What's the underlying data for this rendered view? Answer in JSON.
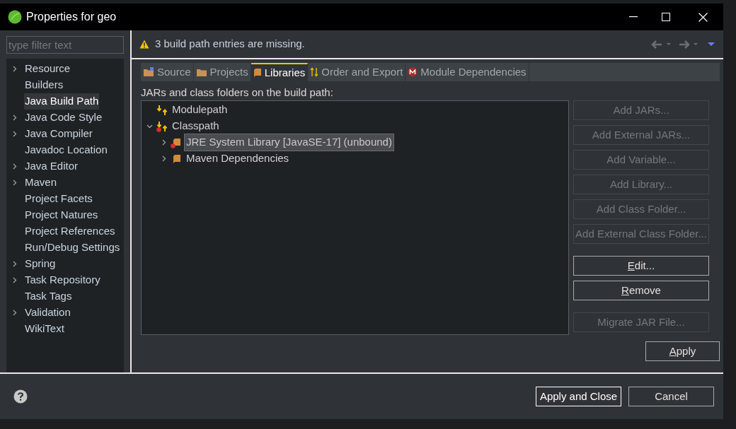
{
  "window": {
    "title": "Properties for geo"
  },
  "filter": {
    "placeholder": "type filter text"
  },
  "sidebar": {
    "items": [
      {
        "label": "Resource",
        "expandable": true,
        "selected": false
      },
      {
        "label": "Builders",
        "expandable": false,
        "selected": false
      },
      {
        "label": "Java Build Path",
        "expandable": false,
        "selected": true
      },
      {
        "label": "Java Code Style",
        "expandable": true,
        "selected": false
      },
      {
        "label": "Java Compiler",
        "expandable": true,
        "selected": false
      },
      {
        "label": "Javadoc Location",
        "expandable": false,
        "selected": false
      },
      {
        "label": "Java Editor",
        "expandable": true,
        "selected": false
      },
      {
        "label": "Maven",
        "expandable": true,
        "selected": false
      },
      {
        "label": "Project Facets",
        "expandable": false,
        "selected": false
      },
      {
        "label": "Project Natures",
        "expandable": false,
        "selected": false
      },
      {
        "label": "Project References",
        "expandable": false,
        "selected": false
      },
      {
        "label": "Run/Debug Settings",
        "expandable": false,
        "selected": false
      },
      {
        "label": "Spring",
        "expandable": true,
        "selected": false
      },
      {
        "label": "Task Repository",
        "expandable": true,
        "selected": false
      },
      {
        "label": "Task Tags",
        "expandable": false,
        "selected": false
      },
      {
        "label": "Validation",
        "expandable": true,
        "selected": false
      },
      {
        "label": "WikiText",
        "expandable": false,
        "selected": false
      }
    ]
  },
  "message": {
    "text": "3 build path entries are missing."
  },
  "tabs": [
    {
      "label": "Source",
      "kind": "source",
      "selected": false
    },
    {
      "label": "Projects",
      "kind": "projects",
      "selected": false
    },
    {
      "label": "Libraries",
      "kind": "libraries",
      "selected": true
    },
    {
      "label": "Order and Export",
      "kind": "order",
      "selected": false
    },
    {
      "label": "Module Dependencies",
      "kind": "module",
      "selected": false
    }
  ],
  "tree_label": "JARs and class folders on the build path:",
  "tree": [
    {
      "label": "Modulepath",
      "kind": "path",
      "error": false,
      "expanded": false,
      "selected": false,
      "expandable": false
    },
    {
      "label": "Classpath",
      "kind": "path",
      "error": true,
      "expanded": true,
      "selected": false,
      "expandable": true,
      "children": [
        {
          "label": "JRE System Library [JavaSE-17] (unbound)",
          "kind": "library",
          "error": true,
          "expanded": false,
          "selected": true,
          "expandable": true
        },
        {
          "label": "Maven Dependencies",
          "kind": "library",
          "error": false,
          "expanded": false,
          "selected": false,
          "expandable": true
        }
      ]
    }
  ],
  "side_buttons": [
    {
      "label": "Add JARs...",
      "disabled": true,
      "mnemonic": false,
      "gap_before": false
    },
    {
      "label": "Add External JARs...",
      "disabled": true,
      "mnemonic": false,
      "gap_before": false
    },
    {
      "label": "Add Variable...",
      "disabled": true,
      "mnemonic": false,
      "gap_before": false
    },
    {
      "label": "Add Library...",
      "disabled": true,
      "mnemonic": false,
      "gap_before": false
    },
    {
      "label": "Add Class Folder...",
      "disabled": true,
      "mnemonic": false,
      "gap_before": false
    },
    {
      "label": "Add External Class Folder...",
      "disabled": true,
      "mnemonic": false,
      "gap_before": false
    },
    {
      "label": "Edit...",
      "disabled": false,
      "mnemonic": true,
      "gap_before": true
    },
    {
      "label": "Remove",
      "disabled": false,
      "mnemonic": true,
      "gap_before": false
    },
    {
      "label": "Migrate JAR File...",
      "disabled": true,
      "mnemonic": false,
      "gap_before": true
    }
  ],
  "apply": {
    "label": "Apply",
    "mnemonic": true
  },
  "footer_buttons": [
    {
      "label": "Apply and Close",
      "default": true
    },
    {
      "label": "Cancel",
      "default": false
    }
  ]
}
